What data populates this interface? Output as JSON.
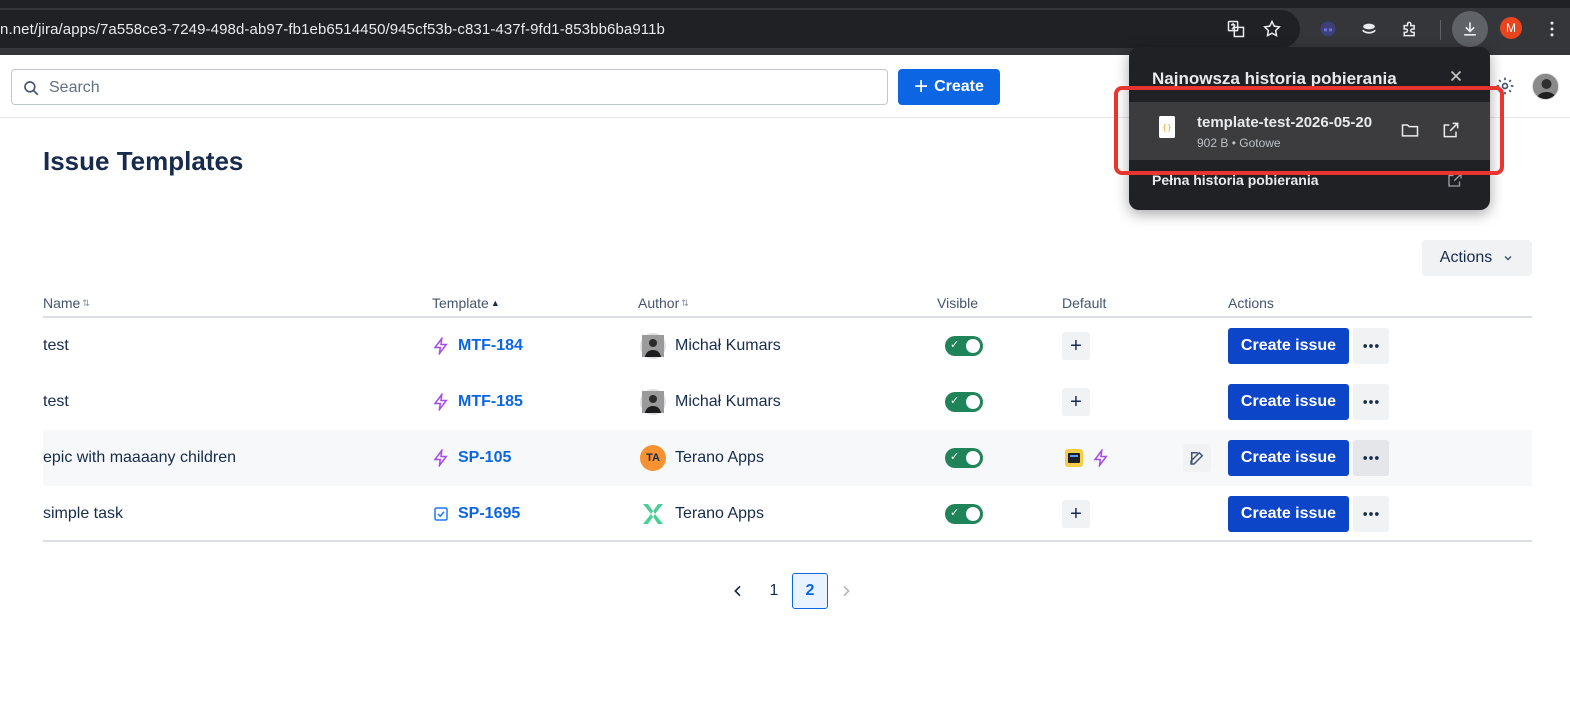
{
  "browser": {
    "url": "n.net/jira/apps/7a558ce3-7249-498d-ab97-fb1eb6514450/945cf53b-c831-437f-9fd1-853bb6ba911b",
    "profile_initial": "M"
  },
  "header": {
    "search_placeholder": "Search",
    "create_label": "Create"
  },
  "page": {
    "title": "Issue Templates",
    "actions_label": "Actions"
  },
  "table": {
    "columns": {
      "name": "Name",
      "template": "Template",
      "author": "Author",
      "visible": "Visible",
      "default": "Default",
      "actions": "Actions"
    },
    "rows": [
      {
        "name": "test",
        "key": "MTF-184",
        "author": "Michał Kumars",
        "create_label": "Create issue"
      },
      {
        "name": "test",
        "key": "MTF-185",
        "author": "Michał Kumars",
        "create_label": "Create issue"
      },
      {
        "name": "epic with maaaany children",
        "key": "SP-105",
        "author": "Terano Apps",
        "author_initials": "TA",
        "create_label": "Create issue"
      },
      {
        "name": "simple task",
        "key": "SP-1695",
        "author": "Terano Apps",
        "create_label": "Create issue"
      }
    ]
  },
  "pagination": {
    "pages": [
      "1",
      "2"
    ],
    "current": "2"
  },
  "downloads": {
    "title": "Najnowsza historia pobierania",
    "file_name": "template-test-2026-05-20",
    "file_meta": "902 B • Gotowe",
    "full_history": "Pełna historia pobierania"
  },
  "colors": {
    "brand_blue": "#0c66e4",
    "button_blue": "#0c45c8",
    "toggle_green": "#1f845a",
    "highlight_red": "#e8352f",
    "popup_bg": "#202124"
  }
}
